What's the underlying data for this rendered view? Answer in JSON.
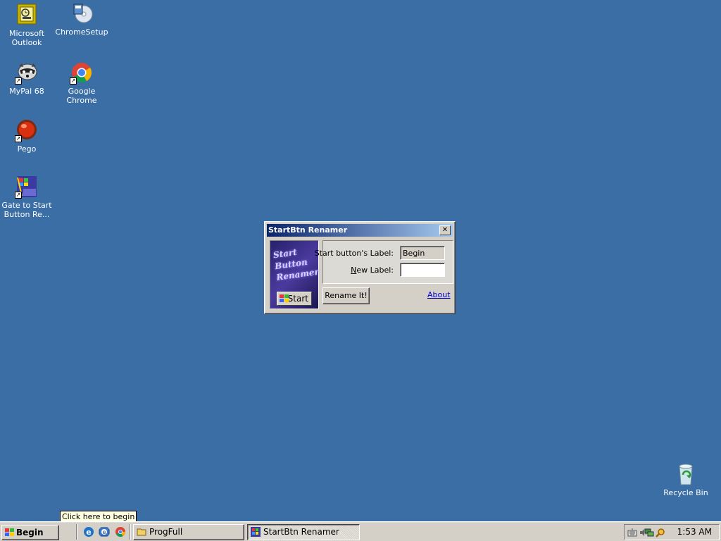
{
  "desktop": {
    "icons": [
      {
        "label_lines": [
          "Microsoft",
          "Outlook"
        ],
        "icon": "outlook-icon"
      },
      {
        "label_lines": [
          "ChromeSetup"
        ],
        "icon": "chrome-setup-icon"
      },
      {
        "label_lines": [
          "MyPal 68"
        ],
        "icon": "mypal-icon"
      },
      {
        "label_lines": [
          "Google Chrome"
        ],
        "icon": "chrome-icon"
      },
      {
        "label_lines": [
          "Pego"
        ],
        "icon": "pego-icon"
      },
      {
        "label_lines": [
          "Gate to Start",
          "Button Re..."
        ],
        "icon": "gate-to-start-icon"
      },
      {
        "label_lines": [
          "Recycle Bin"
        ],
        "icon": "recycle-bin-icon"
      }
    ]
  },
  "dialog": {
    "title": "StartBtn Renamer",
    "logo_lines": [
      "Start",
      "Button",
      "Renamer"
    ],
    "logo_start_label": "Start",
    "current_label_caption": "Start button's Label:",
    "current_label_value": "Begin",
    "new_label_caption": "New Label:",
    "new_label_value": "",
    "rename_button": "Rename It!",
    "about_link": "About",
    "close_glyph": "✕"
  },
  "tooltip": "Click here to begin",
  "taskbar": {
    "start_label": "Begin",
    "quick_launch": [
      "internet-explorer-icon",
      "outlook-express-icon",
      "chrome-icon"
    ],
    "tasks": [
      {
        "label": "ProgFull",
        "active": false,
        "icon": "folder-icon"
      },
      {
        "label": "StartBtn Renamer",
        "active": true,
        "icon": "app-icon"
      }
    ],
    "tray_icons": [
      "keyboard-icon",
      "volume-icon",
      "network-icon",
      "search-icon"
    ],
    "clock": "1:53 AM"
  },
  "colors": {
    "desktop": "#3a6ea5",
    "titlebar_start": "#0a246a",
    "titlebar_end": "#a6caf0",
    "link": "#0000cc"
  }
}
